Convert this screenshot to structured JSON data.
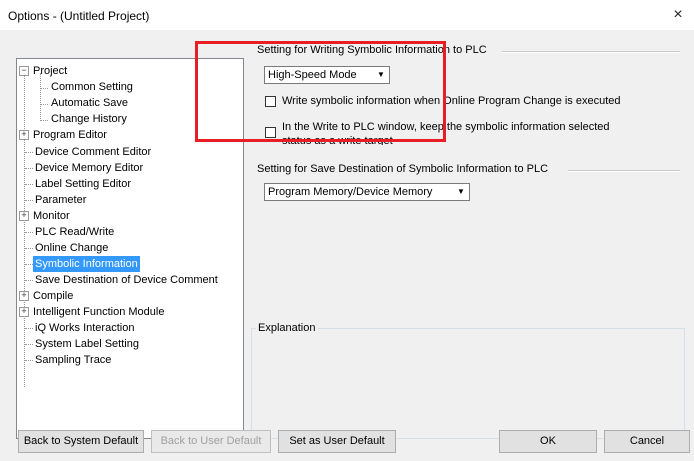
{
  "window": {
    "title": "Options - (Untitled Project)",
    "close_glyph": "×"
  },
  "tree": {
    "items": [
      {
        "label": "Project",
        "expander": "−"
      },
      {
        "label": "Common Setting"
      },
      {
        "label": "Automatic Save"
      },
      {
        "label": "Change History"
      },
      {
        "label": "Program Editor",
        "expander": "+"
      },
      {
        "label": "Device Comment Editor"
      },
      {
        "label": "Device Memory Editor"
      },
      {
        "label": "Label Setting Editor"
      },
      {
        "label": "Parameter"
      },
      {
        "label": "Monitor",
        "expander": "+"
      },
      {
        "label": "PLC Read/Write"
      },
      {
        "label": "Online Change"
      },
      {
        "label": "Symbolic Information",
        "selected": true
      },
      {
        "label": "Save Destination of Device Comment"
      },
      {
        "label": "Compile",
        "expander": "+"
      },
      {
        "label": "Intelligent Function Module",
        "expander": "+"
      },
      {
        "label": "iQ Works Interaction"
      },
      {
        "label": "System Label Setting"
      },
      {
        "label": "Sampling Trace"
      }
    ]
  },
  "writing": {
    "section_title": "Setting for Writing Symbolic Information to PLC",
    "mode_value": "High-Speed Mode",
    "check1_label": "Write symbolic information when Online Program Change is executed",
    "check1_checked": false,
    "check2_label_line1": "In the Write to PLC window, keep the symbolic information selected",
    "check2_label_line2": "status as a write target",
    "check2_checked": false
  },
  "destination": {
    "section_title": "Setting for Save Destination of Symbolic Information to PLC",
    "value": "Program Memory/Device Memory"
  },
  "explanation": {
    "title": "Explanation"
  },
  "buttons": {
    "back_system": "Back to System Default",
    "back_user": "Back to User Default",
    "set_user": "Set as User Default",
    "ok": "OK",
    "cancel": "Cancel"
  },
  "icons": {
    "dropdown": "▼"
  },
  "colors": {
    "selection": "#3399ff",
    "highlight_box": "#e81e24"
  }
}
